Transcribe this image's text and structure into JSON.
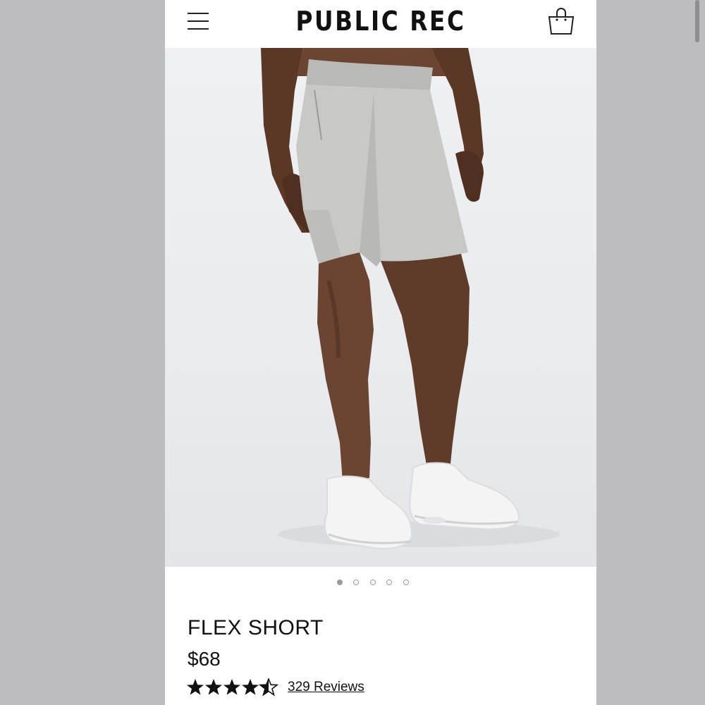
{
  "header": {
    "brand": "PUBLIC REC",
    "menu_icon": "hamburger-menu-icon",
    "cart_icon": "shopping-bag-icon"
  },
  "gallery": {
    "image_alt": "Model wearing light gray flex shorts and white sneakers",
    "slide_count": 5,
    "active_slide": 1
  },
  "product": {
    "title": "FLEX SHORT",
    "price": "$68",
    "rating": 4.5,
    "reviews_label": "329 Reviews"
  },
  "colors": {
    "page_background": "#bdbcc1",
    "short_color": "#c8c8c4",
    "text": "#111111"
  }
}
